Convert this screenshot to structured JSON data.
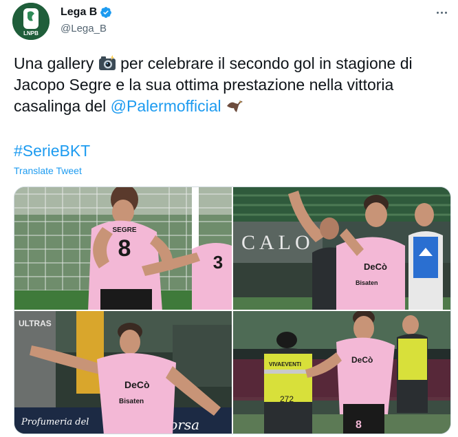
{
  "account": {
    "display_name": "Lega B",
    "handle": "@Lega_B",
    "logo_text": "LNPB",
    "verified": true,
    "verified_color": "#1d9bf0"
  },
  "tweet": {
    "text_part1": "Una gallery",
    "text_part2": " per celebrare il secondo gol in stagione di Jacopo Segre e la sua ottima prestazione nella vittoria casalinga del ",
    "mention": "@Palermofficial",
    "hashtag": "#SerieBKT",
    "translate_label": "Translate Tweet",
    "emoji_camera": "camera-with-flash-emoji",
    "emoji_eagle": "eagle-emoji"
  },
  "photos": [
    {
      "name": "photo-1",
      "texts": {
        "a": "SEGRE",
        "b": "8"
      }
    },
    {
      "name": "photo-2",
      "texts": {
        "a": "CALO",
        "b": "DeCò",
        "c": "Bisaten"
      }
    },
    {
      "name": "photo-3",
      "texts": {
        "a": "ULTRAS",
        "b": "DeCò",
        "c": "Bisaten",
        "d": "Profumeria del",
        "e": "Corsa"
      }
    },
    {
      "name": "photo-4",
      "texts": {
        "a": "VIVAEVENTI",
        "b": "272",
        "c": "DeCò",
        "d": "8"
      }
    }
  ],
  "colors": {
    "link": "#1d9bf0",
    "muted": "#536471",
    "pink": "#f3b8d6"
  }
}
